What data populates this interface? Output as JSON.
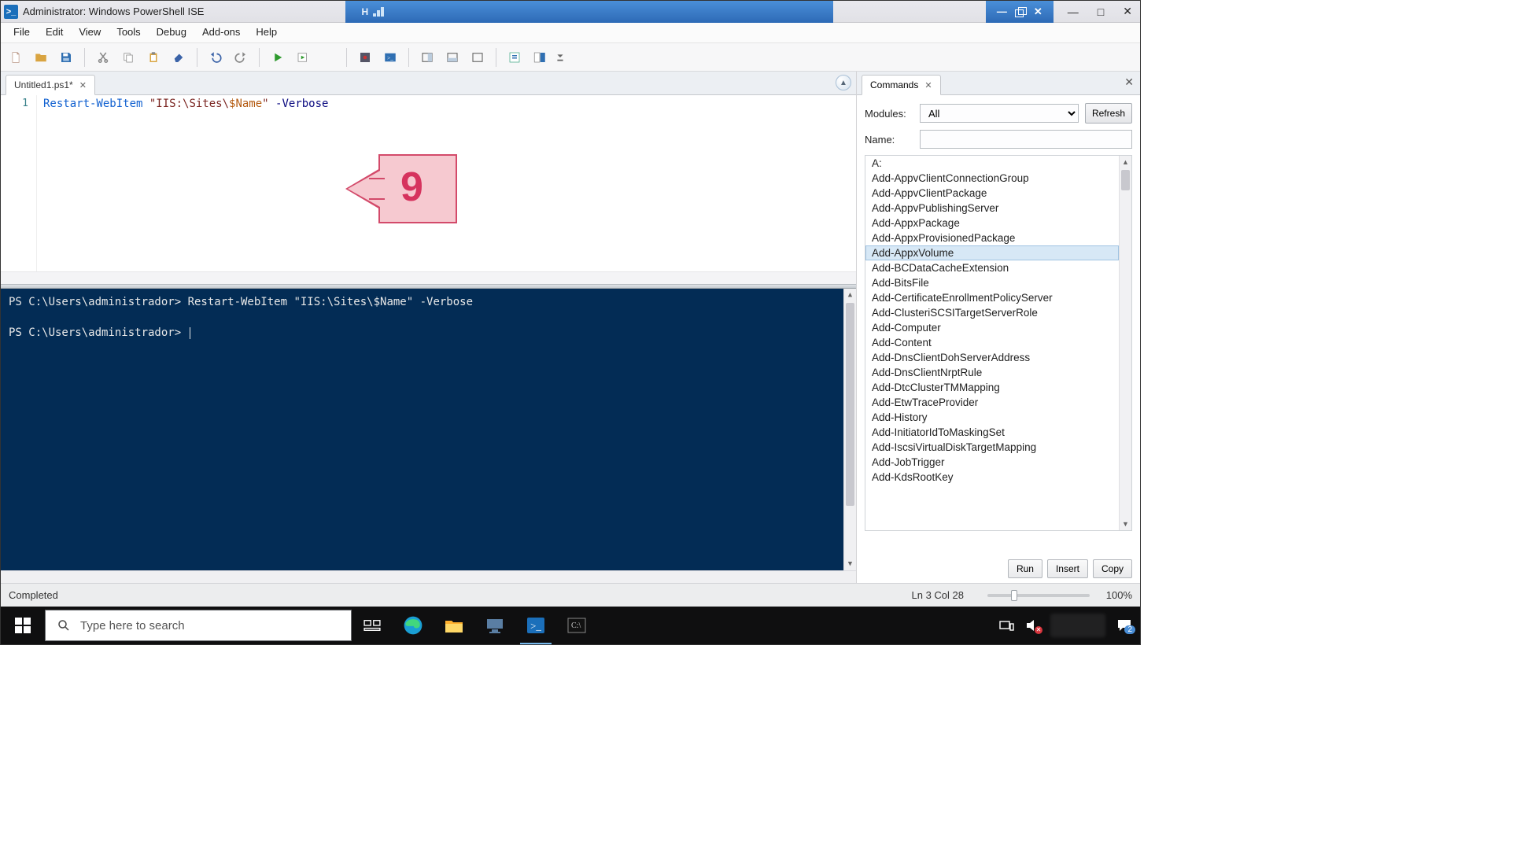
{
  "title": "Administrator: Windows PowerShell ISE",
  "menu": [
    "File",
    "Edit",
    "View",
    "Tools",
    "Debug",
    "Add-ons",
    "Help"
  ],
  "tabs": [
    {
      "label": "Untitled1.ps1*"
    }
  ],
  "editor": {
    "line_no": "1",
    "cmdlet": "Restart-WebItem",
    "str_open": " \"IIS:\\Sites\\",
    "var": "$Name",
    "str_close": "\"",
    "param": " -Verbose"
  },
  "flag_number": "9",
  "console": {
    "prompt1": "PS C:\\Users\\administrador> ",
    "cmd1": "Restart-WebItem \"IIS:\\Sites\\$Name\" -Verbose",
    "prompt2": "PS C:\\Users\\administrador> "
  },
  "commands_pane": {
    "title": "Commands",
    "labels": {
      "modules": "Modules:",
      "name": "Name:"
    },
    "modules_value": "All",
    "refresh": "Refresh",
    "items": [
      "A:",
      "Add-AppvClientConnectionGroup",
      "Add-AppvClientPackage",
      "Add-AppvPublishingServer",
      "Add-AppxPackage",
      "Add-AppxProvisionedPackage",
      "Add-AppxVolume",
      "Add-BCDataCacheExtension",
      "Add-BitsFile",
      "Add-CertificateEnrollmentPolicyServer",
      "Add-ClusteriSCSITargetServerRole",
      "Add-Computer",
      "Add-Content",
      "Add-DnsClientDohServerAddress",
      "Add-DnsClientNrptRule",
      "Add-DtcClusterTMMapping",
      "Add-EtwTraceProvider",
      "Add-History",
      "Add-InitiatorIdToMaskingSet",
      "Add-IscsiVirtualDiskTargetMapping",
      "Add-JobTrigger",
      "Add-KdsRootKey"
    ],
    "selected_index": 6,
    "actions": {
      "run": "Run",
      "insert": "Insert",
      "copy": "Copy"
    }
  },
  "status": {
    "text": "Completed",
    "lncol": "Ln 3  Col 28",
    "zoom": "100%"
  },
  "taskbar": {
    "search_placeholder": "Type here to search",
    "notification_count": "2"
  }
}
